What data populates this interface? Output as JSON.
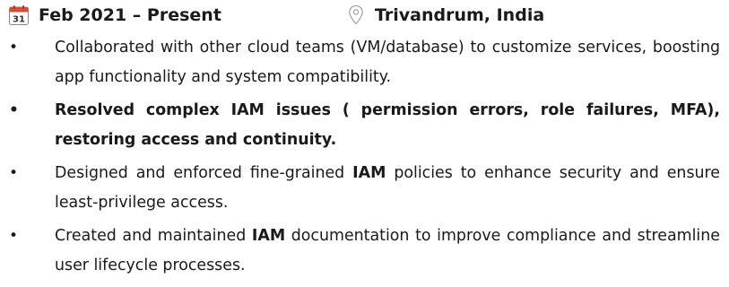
{
  "header": {
    "date_icon": "calendar-icon",
    "date_icon_text": "31",
    "date_range": "Feb 2021 – Present",
    "location_icon": "map-pin-icon",
    "location": "Trivandrum, India"
  },
  "bullets": [
    {
      "text": "Collaborated with other cloud teams (VM/database) to customize services, boosting app functionality and system compatibility."
    },
    {
      "text": "Resolved complex IAM issues ( permission errors, role failures, MFA), restoring access and continuity."
    },
    {
      "before": "Designed and enforced fine-grained ",
      "bold": "IAM",
      "after": " policies to enhance security and ensure least-privilege access."
    },
    {
      "before": "Created and maintained ",
      "bold": "IAM",
      "after": " documentation to improve compliance and streamline user lifecycle processes."
    }
  ],
  "colors": {
    "text": "#1a1a1a",
    "calendar_red": "#d84a3a",
    "icon_gray": "#9a9a9a"
  }
}
